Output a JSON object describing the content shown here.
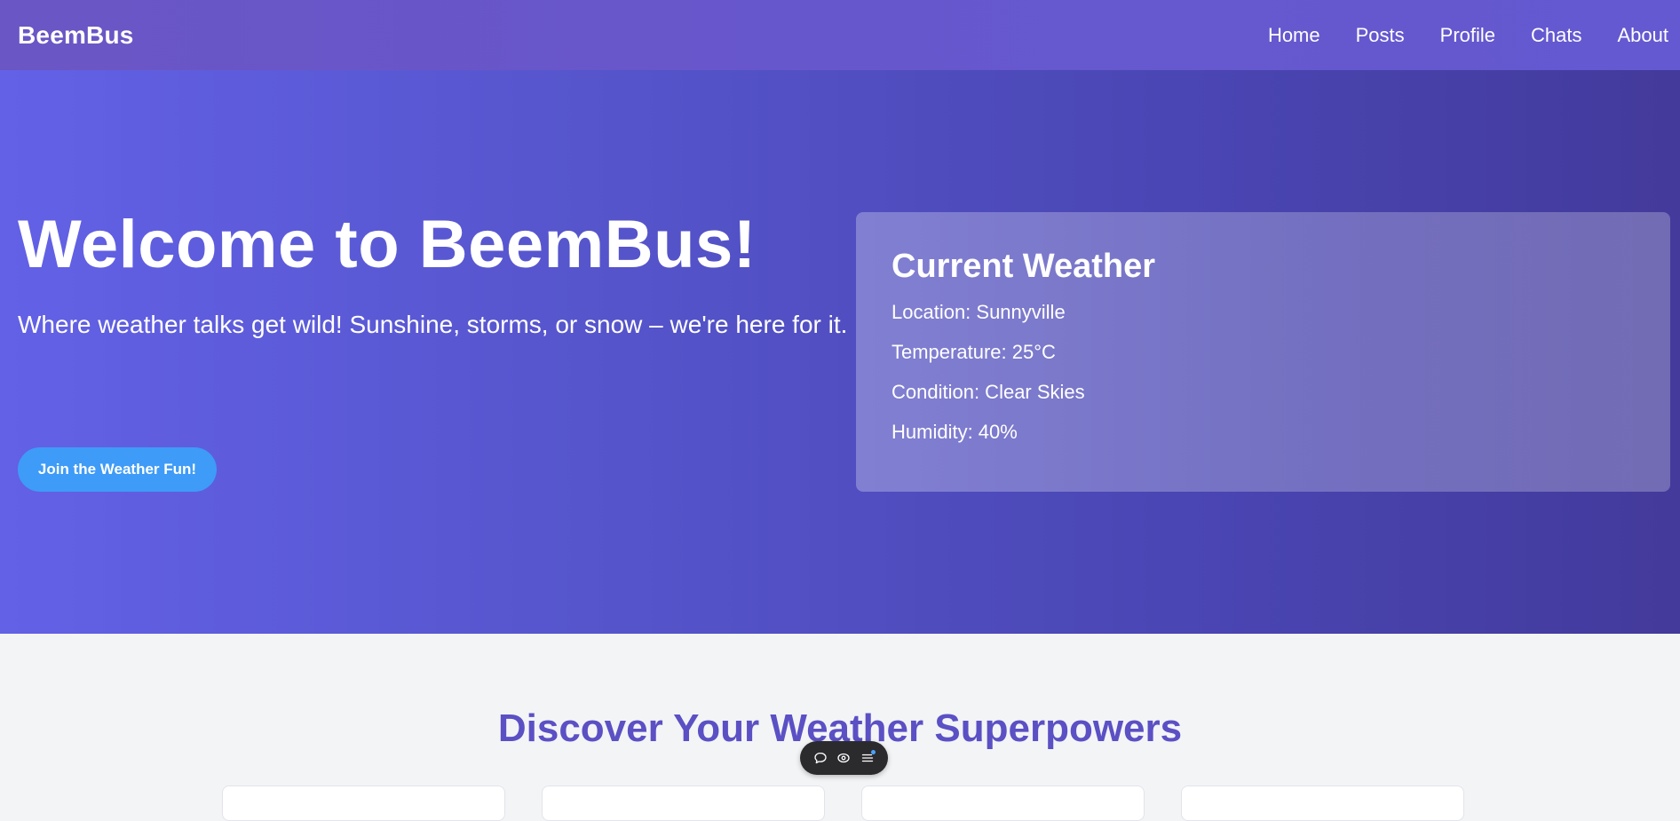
{
  "navbar": {
    "brand": "BeemBus",
    "links": [
      "Home",
      "Posts",
      "Profile",
      "Chats",
      "About"
    ]
  },
  "hero": {
    "title": "Welcome to BeemBus!",
    "subtitle": "Where weather talks get wild! Sunshine, storms, or snow – we're here for it.",
    "cta_label": "Join the Weather Fun!"
  },
  "weather": {
    "title": "Current Weather",
    "location": "Location: Sunnyville",
    "temperature": "Temperature: 25°C",
    "condition": "Condition: Clear Skies",
    "humidity": "Humidity: 40%"
  },
  "features": {
    "title": "Discover Your Weather Superpowers"
  },
  "toolbar": {
    "icons": [
      "chat-bubble-icon",
      "view-icon",
      "menu-icon"
    ],
    "accent_color": "#4aa3ff"
  },
  "colors": {
    "nav_bg": "#6757cd",
    "hero_start": "#6361e6",
    "hero_end": "#433a9b",
    "cta_bg": "#3e9bf7",
    "section_title": "#5b50c4",
    "section_bg": "#f3f4f6"
  }
}
